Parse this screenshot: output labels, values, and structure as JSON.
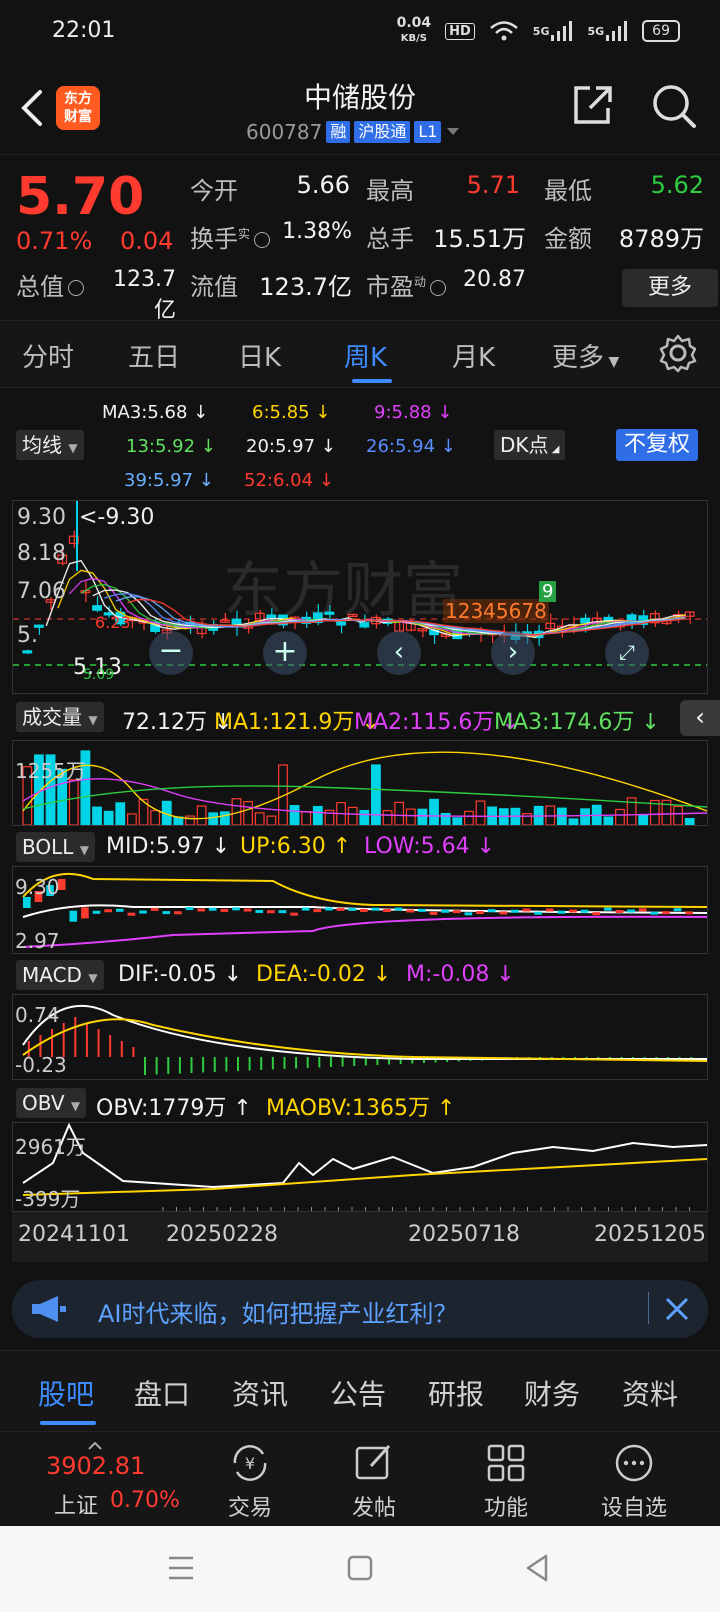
{
  "status": {
    "time": "22:01",
    "speed": "0.04",
    "speed_unit": "KB/S",
    "hd": "HD",
    "net1": "5G",
    "net2": "5G",
    "battery": "69"
  },
  "header": {
    "logo_line1": "东方",
    "logo_line2": "财富",
    "title": "中储股份",
    "code": "600787",
    "tag1": "融",
    "tag2": "沪股通",
    "tag3": "L1"
  },
  "quote": {
    "price": "5.70",
    "pct": "0.71%",
    "chg": "0.04",
    "open_label": "今开",
    "open": "5.66",
    "high_label": "最高",
    "high": "5.71",
    "low_label": "最低",
    "low": "5.62",
    "turnover_label": "换手",
    "turnover_sup": "实",
    "turnover": "1.38%",
    "volume_label": "总手",
    "volume": "15.51万",
    "amount_label": "金额",
    "amount": "8789万",
    "mktcap_label": "总值",
    "mktcap": "123.7亿",
    "float_label": "流值",
    "float": "123.7亿",
    "pe_label": "市盈",
    "pe_sup": "动",
    "pe": "20.87",
    "more": "更多"
  },
  "period_tabs": [
    "分时",
    "五日",
    "日K",
    "周K",
    "月K",
    "更多"
  ],
  "ma": {
    "selector": "均线",
    "dk": "DK点",
    "fq": "不复权",
    "ma3": "MA3:5.68 ↓",
    "ma6": "6:5.85 ↓",
    "ma9": "9:5.88 ↓",
    "ma13": "13:5.92 ↓",
    "ma20": "20:5.97 ↓",
    "ma26": "26:5.94 ↓",
    "ma39": "39:5.97 ↓",
    "ma52": "52:6.04 ↓"
  },
  "kline": {
    "y_top": "9.30",
    "y2": "8.18",
    "y3": "7.06",
    "y4": "5.",
    "y_low": "5.13",
    "max_label": "<-9.30",
    "ref_label": "6.23",
    "low_label": "5.09",
    "watermark": "东方财富",
    "nums": "12345678",
    "nine": "9"
  },
  "vol": {
    "selector": "成交量",
    "v": "72.12万 ↓",
    "ma1": "MA1:121.9万 ↓",
    "ma2": "MA2:115.6万 ↓",
    "ma3": "MA3:174.6万 ↓",
    "y": "1255万"
  },
  "boll": {
    "selector": "BOLL",
    "mid": "MID:5.97 ↓",
    "up": "UP:6.30 ↑",
    "low": "LOW:5.64 ↓",
    "y1": "9.30",
    "y2": "2.97"
  },
  "macd": {
    "selector": "MACD",
    "dif": "DIF:-0.05 ↓",
    "dea": "DEA:-0.02 ↓",
    "m": "M:-0.08 ↓",
    "y1": "0.74",
    "y2": "-0.23"
  },
  "obv": {
    "selector": "OBV",
    "obv": "OBV:1779万 ↑",
    "maobv": "MAOBV:1365万 ↑",
    "y1": "2961万",
    "y2": "-399万"
  },
  "dates": [
    "20241101",
    "20250228",
    "20250718",
    "20251205"
  ],
  "banner": {
    "text": "AI时代来临，如何把握产业红利？"
  },
  "bottom_tabs": [
    "股吧",
    "盘口",
    "资讯",
    "公告",
    "研报",
    "财务",
    "资料"
  ],
  "actions": {
    "index_value": "3902.81",
    "index_name": "上证",
    "index_pct": "0.70%",
    "trade": "交易",
    "post": "发帖",
    "func": "功能",
    "watch": "设自选"
  },
  "colors": {
    "up": "#ff3b30",
    "down": "#2ecc40",
    "accent": "#3c8cff",
    "cyan": "#00d4e6"
  }
}
